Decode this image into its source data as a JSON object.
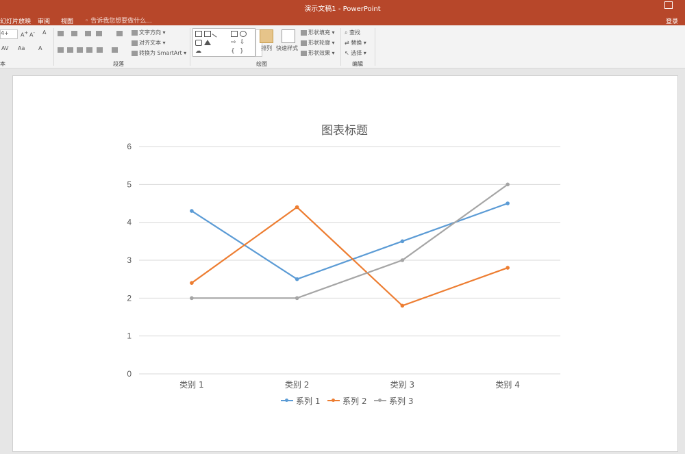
{
  "window": {
    "title": "演示文稿1 - PowerPoint"
  },
  "tabs": [
    {
      "label": "幻灯片放映"
    },
    {
      "label": "审阅"
    },
    {
      "label": "视图"
    }
  ],
  "tell_me": "告诉我您想要做什么...",
  "login": "登录",
  "ribbon": {
    "groups": {
      "font_partial": "本",
      "paragraph": "段落",
      "drawing": "绘图",
      "editing": "编辑"
    },
    "font_size": "4+",
    "text_direction": "文字方向",
    "align_text": "对齐文本",
    "convert_smartart": "转换为 SmartArt",
    "arrange": "排列",
    "quick_styles": "快速样式",
    "shape_fill": "形状填充",
    "shape_outline": "形状轮廓",
    "shape_effects": "形状效果",
    "find": "查找",
    "replace": "替换",
    "select": "选择"
  },
  "chart_data": {
    "type": "line",
    "title": "图表标题",
    "categories": [
      "类别 1",
      "类别 2",
      "类别 3",
      "类别 4"
    ],
    "yticks": [
      "0",
      "1",
      "2",
      "3",
      "4",
      "5",
      "6"
    ],
    "ylim": [
      0,
      6
    ],
    "grid": true,
    "legend_position": "bottom",
    "series": [
      {
        "name": "系列 1",
        "color": "#5b9bd5",
        "values": [
          4.3,
          2.5,
          3.5,
          4.5
        ]
      },
      {
        "name": "系列 2",
        "color": "#ed7d31",
        "values": [
          2.4,
          4.4,
          1.8,
          2.8
        ]
      },
      {
        "name": "系列 3",
        "color": "#a5a5a5",
        "values": [
          2,
          2,
          3,
          5
        ]
      }
    ]
  }
}
